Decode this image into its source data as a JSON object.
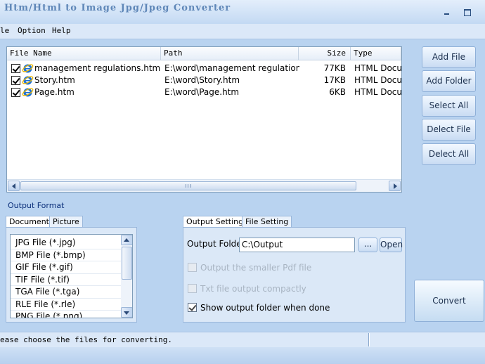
{
  "window": {
    "title": "Htm/Html to Image Jpg/Jpeg Converter"
  },
  "menu": [
    "le",
    "Option",
    "Help"
  ],
  "file_list": {
    "columns": [
      "File Name",
      "Path",
      "Size",
      "Type"
    ],
    "rows": [
      {
        "name": "management regulations.htm",
        "path": "E:\\word\\management regulations.htm",
        "size": "77KB",
        "type": "HTML Docun"
      },
      {
        "name": "Story.htm",
        "path": "E:\\word\\Story.htm",
        "size": "17KB",
        "type": "HTML Docun"
      },
      {
        "name": "Page.htm",
        "path": "E:\\word\\Page.htm",
        "size": "6KB",
        "type": "HTML Docun"
      }
    ]
  },
  "buttons": {
    "add_file": "Add File",
    "add_folder": "Add Folder",
    "select_all": "Select All",
    "deselect_file": "Delect File",
    "deselect_all": "Delect All",
    "convert": "Convert"
  },
  "output_format": {
    "label": "Output Format",
    "tabs": [
      "Document",
      "Picture"
    ],
    "formats": [
      "JPG File  (*.jpg)",
      "BMP File  (*.bmp)",
      "GIF File  (*.gif)",
      "TIF File  (*.tif)",
      "TGA File  (*.tga)",
      "RLE File  (*.rle)",
      "PNG File  (*.png)"
    ]
  },
  "output_settings": {
    "tabs": [
      "Output Setting",
      "File Setting"
    ],
    "folder_label": "Output Folder",
    "folder_value": "C:\\Output",
    "browse_label": "...",
    "open_label": "Open",
    "options": [
      {
        "label": "Output the smaller Pdf file",
        "checked": false,
        "enabled": false
      },
      {
        "label": "Txt file output compactly",
        "checked": false,
        "enabled": false
      },
      {
        "label": "Show output folder when done",
        "checked": true,
        "enabled": true
      }
    ]
  },
  "status": {
    "text": "ease choose the files for converting."
  }
}
